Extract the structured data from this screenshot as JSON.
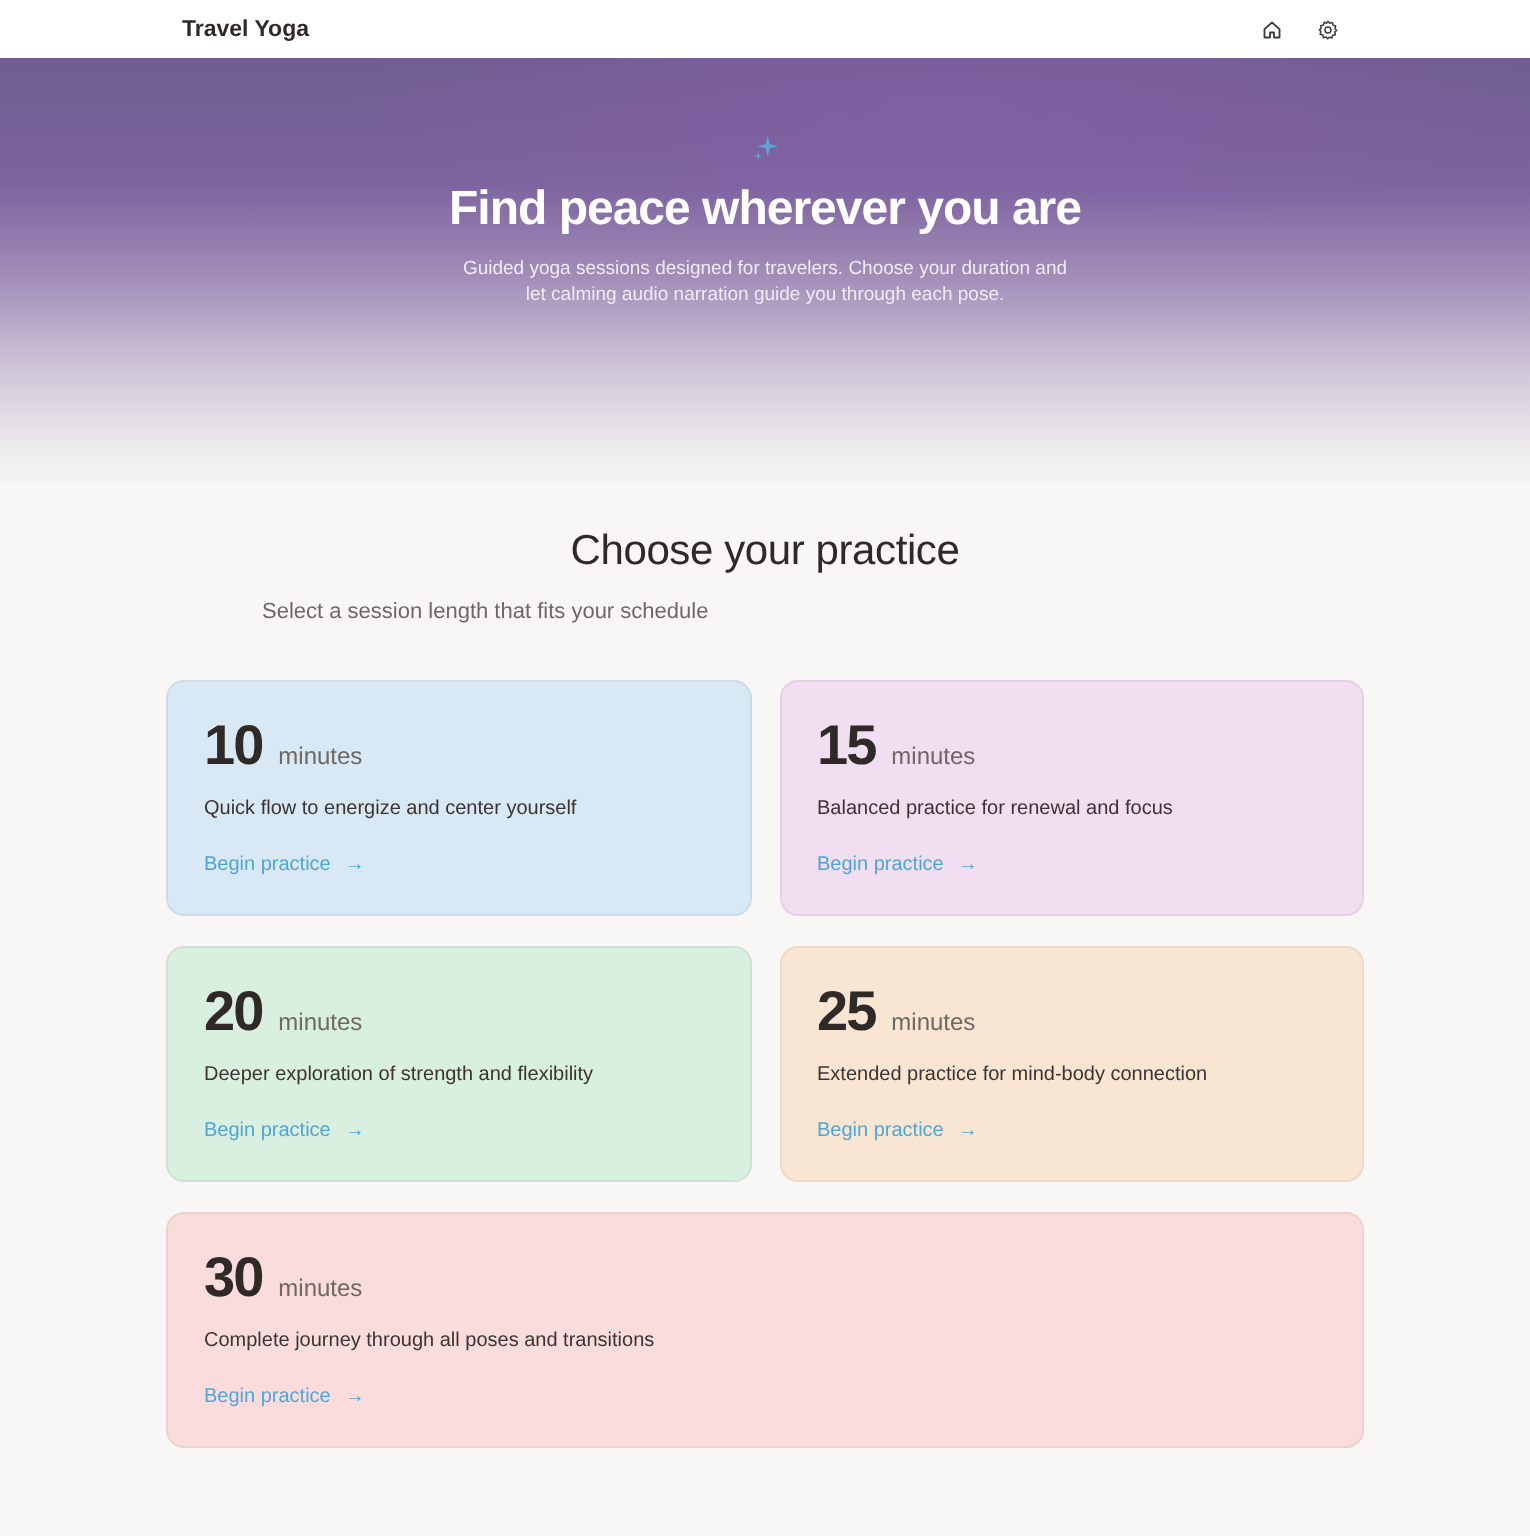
{
  "header": {
    "title": "Travel Yoga"
  },
  "hero": {
    "title": "Find peace wherever you are",
    "subtitle": "Guided yoga sessions designed for travelers. Choose your duration and let calming audio narration guide you through each pose."
  },
  "practice": {
    "title": "Choose your practice",
    "subtitle": "Select a session length that fits your schedule",
    "sessions": [
      {
        "duration": "10",
        "unit": "minutes",
        "description": "Quick flow to energize and center yourself",
        "link": "Begin practice",
        "arrow": "→",
        "color": "#d8e8f4"
      },
      {
        "duration": "15",
        "unit": "minutes",
        "description": "Balanced practice for renewal and focus",
        "link": "Begin practice",
        "arrow": "→",
        "color": "#f1def1"
      },
      {
        "duration": "20",
        "unit": "minutes",
        "description": "Deeper exploration of strength and flexibility",
        "link": "Begin practice",
        "arrow": "→",
        "color": "#d9efe0"
      },
      {
        "duration": "25",
        "unit": "minutes",
        "description": "Extended practice for mind-body connection",
        "link": "Begin practice",
        "arrow": "→",
        "color": "#f9e6d2"
      },
      {
        "duration": "30",
        "unit": "minutes",
        "description": "Complete journey through all poses and transitions",
        "link": "Begin practice",
        "arrow": "→",
        "color": "#fadcdc"
      }
    ]
  }
}
